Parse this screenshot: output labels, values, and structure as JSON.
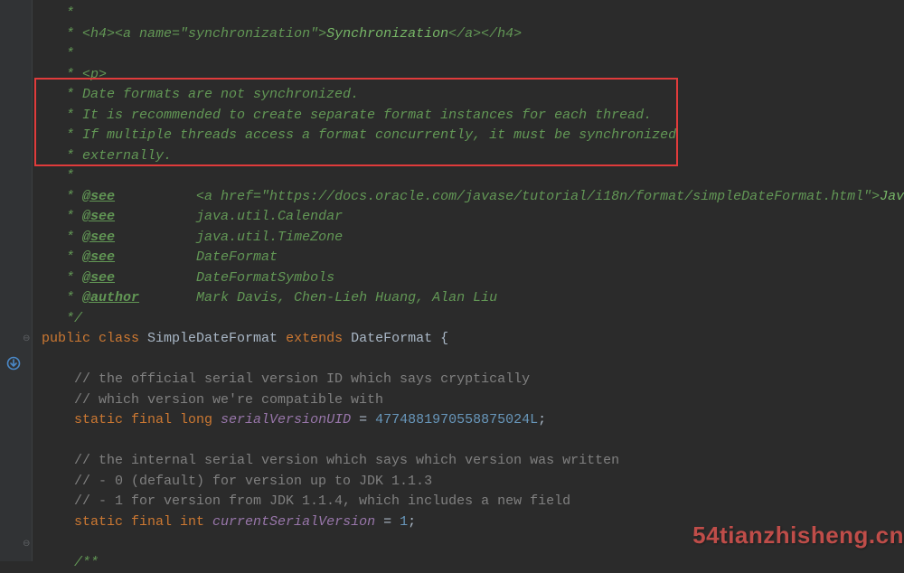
{
  "lines": {
    "l0": " *",
    "l1_pre": " * ",
    "l1_h4o": "<h4>",
    "l1_a1": "<a name=\"synchronization\">",
    "l1_txt": "Synchronization",
    "l1_a2": "</a></h4>",
    "l2": " *",
    "l3_pre": " * ",
    "l3_p": "<p>",
    "l4": " * Date formats are not synchronized.",
    "l5": " * It is recommended to create separate format instances for each thread.",
    "l6": " * If multiple threads access a format concurrently, it must be synchronized",
    "l7": " * externally.",
    "l8": " *",
    "l9_pre": " * ",
    "see": "@see",
    "l9_gap": "          ",
    "l9_a": "<a href=\"https://docs.oracle.com/javase/tutorial/i18n/format/simpleDateFormat.html\">",
    "l9_t": "Java Tutor",
    "l10_t": "          java.util.Calendar",
    "l11_t": "          java.util.TimeZone",
    "l12_t": "          DateFormat",
    "l13_t": "          DateFormatSymbols",
    "author": "@author",
    "l14_t": "       Mark Davis, Chen-Lieh Huang, Alan Liu",
    "l15": " */",
    "kw_public": "public ",
    "kw_class": "class ",
    "cls_sdf": "SimpleDateFormat ",
    "kw_extends": "extends ",
    "cls_df": "DateFormat ",
    "brace_open": "{",
    "c1": "// the official serial version ID which says cryptically",
    "c2": "// which version we're compatible with",
    "kw_static": "static ",
    "kw_final": "final ",
    "kw_long": "long ",
    "fld_suid": "serialVersionUID",
    "eq": " = ",
    "num_suid": "4774881970558875024L",
    "semi": ";",
    "c3": "// the internal serial version which says which version was written",
    "c4": "// - 0 (default) for version up to JDK 1.1.3",
    "c5": "// - 1 for version from JDK 1.1.4, which includes a new field",
    "kw_int": "int ",
    "fld_csv": "currentSerialVersion",
    "num_1": "1",
    "doc_open": "/**"
  },
  "watermark": "54tianzhisheng.cn"
}
